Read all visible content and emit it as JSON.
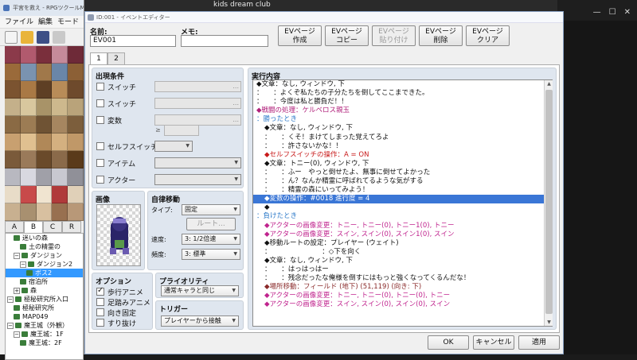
{
  "zoom_label": "kids dream club",
  "main_window": {
    "title": "平宮を救え - RPGツクールMV",
    "menu": [
      "ファイル",
      "編集",
      "モード"
    ],
    "tileset_tabs": [
      "A",
      "B",
      "C",
      "R"
    ],
    "tree": [
      {
        "label": "迷いの森",
        "indent": 1,
        "expander": "",
        "selected": false
      },
      {
        "label": "土の精霊の",
        "indent": 2,
        "expander": "",
        "selected": false
      },
      {
        "label": "ダンジョン",
        "indent": 1,
        "expander": "−",
        "selected": false
      },
      {
        "label": "ダンジョン2",
        "indent": 2,
        "expander": "−",
        "selected": false
      },
      {
        "label": "ボス2",
        "indent": 3,
        "expander": "",
        "selected": true
      },
      {
        "label": "宿泊所",
        "indent": 2,
        "expander": "",
        "selected": false
      },
      {
        "label": "森",
        "indent": 1,
        "expander": "+",
        "selected": false
      },
      {
        "label": "極秘研究所入口",
        "indent": 0,
        "expander": "−",
        "selected": false
      },
      {
        "label": "極秘研究所",
        "indent": 1,
        "expander": "",
        "selected": false
      },
      {
        "label": "MAP049",
        "indent": 1,
        "expander": "",
        "selected": false
      },
      {
        "label": "魔王城（外観）",
        "indent": 0,
        "expander": "−",
        "selected": false
      },
      {
        "label": "魔王城：1F",
        "indent": 1,
        "expander": "−",
        "selected": false
      },
      {
        "label": "魔王城：2F",
        "indent": 2,
        "expander": "",
        "selected": false
      }
    ]
  },
  "dialog": {
    "title": "ID:001 - イベントエディター",
    "name_label": "名前:",
    "name_value": "EV001",
    "memo_label": "メモ:",
    "memo_value": "",
    "ev_buttons": [
      {
        "line1": "EVページ",
        "line2": "作成",
        "disabled": false
      },
      {
        "line1": "EVページ",
        "line2": "コピー",
        "disabled": false
      },
      {
        "line1": "EVページ",
        "line2": "貼り付け",
        "disabled": true
      },
      {
        "line1": "EVページ",
        "line2": "削除",
        "disabled": false
      },
      {
        "line1": "EVページ",
        "line2": "クリア",
        "disabled": false
      }
    ],
    "page_tabs": [
      "1",
      "2"
    ],
    "conditions": {
      "title": "出現条件",
      "switch1": "スイッチ",
      "switch2": "スイッチ",
      "variable": "変数",
      "gte": "≥",
      "self_switch": "セルフスイッチ",
      "item": "アイテム",
      "actor": "アクター",
      "ellipsis": "..."
    },
    "image": {
      "title": "画像"
    },
    "autonomous": {
      "title": "自律移動",
      "type_label": "タイプ:",
      "type_value": "固定",
      "route_button": "ルート...",
      "speed_label": "速度:",
      "speed_value": "3: 1/2倍速",
      "freq_label": "頻度:",
      "freq_value": "3: 標準"
    },
    "options": {
      "title": "オプション",
      "items": [
        {
          "label": "歩行アニメ",
          "checked": true
        },
        {
          "label": "足踏みアニメ",
          "checked": false
        },
        {
          "label": "向き固定",
          "checked": false
        },
        {
          "label": "すり抜け",
          "checked": false
        }
      ]
    },
    "priority": {
      "title": "プライオリティ",
      "value": "通常キャラと同じ"
    },
    "trigger": {
      "title": "トリガー",
      "value": "プレイヤーから接触"
    },
    "contents": {
      "title": "実行内容",
      "commands": [
        {
          "text": "◆文章：なし, ウィンドウ, 下",
          "color": "#111111",
          "indent": 0
        },
        {
          "text": "：　　：よくぞ私たちの子分たちを倒してここまできた。",
          "color": "#111111",
          "indent": 0
        },
        {
          "text": "：　　：今度は私と勝負だ！！",
          "color": "#111111",
          "indent": 0
        },
        {
          "text": "◆戦闘の処理：ケルベロス親玉",
          "color": "#b0207a",
          "indent": 0
        },
        {
          "text": "：勝ったとき",
          "color": "#2a78c8",
          "indent": 0
        },
        {
          "text": "◆文章：なし, ウィンドウ, 下",
          "color": "#111111",
          "indent": 1
        },
        {
          "text": "：　　：くそ！まけてしまった覚えてろよ",
          "color": "#111111",
          "indent": 1
        },
        {
          "text": "：　　：許さないかな！！",
          "color": "#111111",
          "indent": 1
        },
        {
          "text": "◆セルフスイッチの操作：A = ON",
          "color": "#c81a1a",
          "indent": 1
        },
        {
          "text": "◆文章：トニー(0), ウィンドウ, 下",
          "color": "#111111",
          "indent": 1
        },
        {
          "text": "：　　：ふー　やっと倒せたよ、無事に倒せてよかった",
          "color": "#111111",
          "indent": 1
        },
        {
          "text": "：　　：ん？なんか精霊に呼ばれてるような気がする",
          "color": "#111111",
          "indent": 1
        },
        {
          "text": "：　　：精霊の森にいってみよう！",
          "color": "#111111",
          "indent": 1
        },
        {
          "text": "◆変数の操作：#0018 進行度 = 4",
          "color": "#ffffff",
          "indent": 1,
          "selected": true
        },
        {
          "text": "◆",
          "color": "#111111",
          "indent": 1
        },
        {
          "text": "：負けたとき",
          "color": "#2a78c8",
          "indent": 0
        },
        {
          "text": "◆アクターの画像変更：トニー, トニー(0), トニー1(0), トニー",
          "color": "#c0248e",
          "indent": 1
        },
        {
          "text": "◆アクターの画像変更：スイン, スイン(0), スイン1(0), スイン",
          "color": "#c0248e",
          "indent": 1
        },
        {
          "text": "◆移動ルートの設定：プレイヤー (ウェイト)",
          "color": "#111111",
          "indent": 1
        },
        {
          "text": "：　　　　　　　　：◇下を向く",
          "color": "#111111",
          "indent": 1
        },
        {
          "text": "◆文章：なし, ウィンドウ, 下",
          "color": "#111111",
          "indent": 1
        },
        {
          "text": "：　　：はっはっはー",
          "color": "#111111",
          "indent": 1
        },
        {
          "text": "：　　：残念だったな俺様を倒すにはもっと強くなってくるんだな！",
          "color": "#111111",
          "indent": 1
        },
        {
          "text": "◆場所移動：フィールド (地下) (51,119) (向き: 下)",
          "color": "#8a2a2a",
          "indent": 1
        },
        {
          "text": "◆アクターの画像変更：トニー, トニー(0), トニー(0), トニー",
          "color": "#c0248e",
          "indent": 1
        },
        {
          "text": "◆アクターの画像変更：スイン, スイン(0), スイン(0), スイン",
          "color": "#c0248e",
          "indent": 1
        }
      ]
    },
    "buttons": {
      "ok": "OK",
      "cancel": "キャンセル",
      "apply": "適用"
    }
  }
}
